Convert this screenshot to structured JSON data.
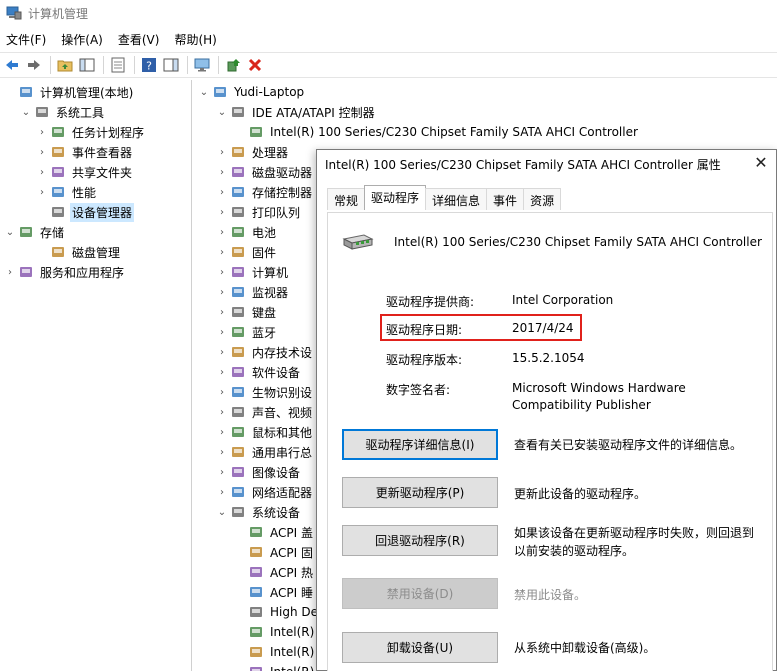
{
  "window": {
    "title": "计算机管理"
  },
  "menu": [
    "文件(F)",
    "操作(A)",
    "查看(V)",
    "帮助(H)"
  ],
  "toolbar_icons": [
    "back-arrow-icon",
    "forward-arrow-icon",
    "folder-up-icon",
    "show-hide-tree-icon",
    "properties-icon",
    "help-icon",
    "action-pane-icon",
    "monitor-icon",
    "update-driver-icon",
    "uninstall-x-icon"
  ],
  "left_tree": [
    {
      "label": "计算机管理(本地)",
      "chev": "",
      "indent": 0
    },
    {
      "label": "系统工具",
      "chev": "v",
      "indent": 1
    },
    {
      "label": "任务计划程序",
      "chev": ">",
      "indent": 2
    },
    {
      "label": "事件查看器",
      "chev": ">",
      "indent": 2
    },
    {
      "label": "共享文件夹",
      "chev": ">",
      "indent": 2
    },
    {
      "label": "性能",
      "chev": ">",
      "indent": 2
    },
    {
      "label": "设备管理器",
      "chev": "",
      "indent": 2,
      "selected": true
    },
    {
      "label": "存储",
      "chev": "v",
      "indent": 0
    },
    {
      "label": "磁盘管理",
      "chev": "",
      "indent": 2
    },
    {
      "label": "服务和应用程序",
      "chev": ">",
      "indent": 0
    }
  ],
  "device_tree": [
    {
      "label": "Yudi-Laptop",
      "chev": "v",
      "indent": 0
    },
    {
      "label": "IDE ATA/ATAPI 控制器",
      "chev": "v",
      "indent": 1
    },
    {
      "label": "Intel(R) 100 Series/C230 Chipset Family SATA AHCI Controller",
      "chev": "",
      "indent": 2
    },
    {
      "label": "处理器",
      "chev": ">",
      "indent": 1
    },
    {
      "label": "磁盘驱动器",
      "chev": ">",
      "indent": 1
    },
    {
      "label": "存储控制器",
      "chev": ">",
      "indent": 1
    },
    {
      "label": "打印队列",
      "chev": ">",
      "indent": 1
    },
    {
      "label": "电池",
      "chev": ">",
      "indent": 1
    },
    {
      "label": "固件",
      "chev": ">",
      "indent": 1
    },
    {
      "label": "计算机",
      "chev": ">",
      "indent": 1
    },
    {
      "label": "监视器",
      "chev": ">",
      "indent": 1
    },
    {
      "label": "键盘",
      "chev": ">",
      "indent": 1
    },
    {
      "label": "蓝牙",
      "chev": ">",
      "indent": 1
    },
    {
      "label": "内存技术设",
      "chev": ">",
      "indent": 1
    },
    {
      "label": "软件设备",
      "chev": ">",
      "indent": 1
    },
    {
      "label": "生物识别设",
      "chev": ">",
      "indent": 1
    },
    {
      "label": "声音、视频",
      "chev": ">",
      "indent": 1
    },
    {
      "label": "鼠标和其他",
      "chev": ">",
      "indent": 1
    },
    {
      "label": "通用串行总",
      "chev": ">",
      "indent": 1
    },
    {
      "label": "图像设备",
      "chev": ">",
      "indent": 1
    },
    {
      "label": "网络适配器",
      "chev": ">",
      "indent": 1
    },
    {
      "label": "系统设备",
      "chev": "v",
      "indent": 1
    },
    {
      "label": "ACPI 盖",
      "chev": "",
      "indent": 2
    },
    {
      "label": "ACPI 固",
      "chev": "",
      "indent": 2
    },
    {
      "label": "ACPI 热",
      "chev": "",
      "indent": 2
    },
    {
      "label": "ACPI 睡",
      "chev": "",
      "indent": 2
    },
    {
      "label": "High De",
      "chev": "",
      "indent": 2
    },
    {
      "label": "Intel(R)",
      "chev": "",
      "indent": 2
    },
    {
      "label": "Intel(R)",
      "chev": "",
      "indent": 2
    },
    {
      "label": "Intel(R)",
      "chev": "",
      "indent": 2
    }
  ],
  "dialog": {
    "title": "Intel(R) 100 Series/C230 Chipset Family SATA AHCI Controller 属性",
    "close": "✕",
    "tabs": [
      "常规",
      "驱动程序",
      "详细信息",
      "事件",
      "资源"
    ],
    "active_tab": "驱动程序",
    "device_name": "Intel(R) 100 Series/C230 Chipset Family SATA AHCI Controller",
    "props": {
      "provider_label": "驱动程序提供商:",
      "provider_value": "Intel Corporation",
      "date_label": "驱动程序日期:",
      "date_value": "2017/4/24",
      "version_label": "驱动程序版本:",
      "version_value": "15.5.2.1054",
      "signer_label": "数字签名者:",
      "signer_value_1": "Microsoft Windows Hardware",
      "signer_value_2": "Compatibility Publisher"
    },
    "buttons": {
      "details": "驱动程序详细信息(I)",
      "details_desc": "查看有关已安装驱动程序文件的详细信息。",
      "update": "更新驱动程序(P)",
      "update_desc": "更新此设备的驱动程序。",
      "rollback": "回退驱动程序(R)",
      "rollback_desc_1": "如果该设备在更新驱动程序时失败，则回退到",
      "rollback_desc_2": "以前安装的驱动程序。",
      "disable": "禁用设备(D)",
      "disable_desc": "禁用此设备。",
      "uninstall": "卸载设备(U)",
      "uninstall_desc": "从系统中卸载设备(高级)。"
    }
  }
}
